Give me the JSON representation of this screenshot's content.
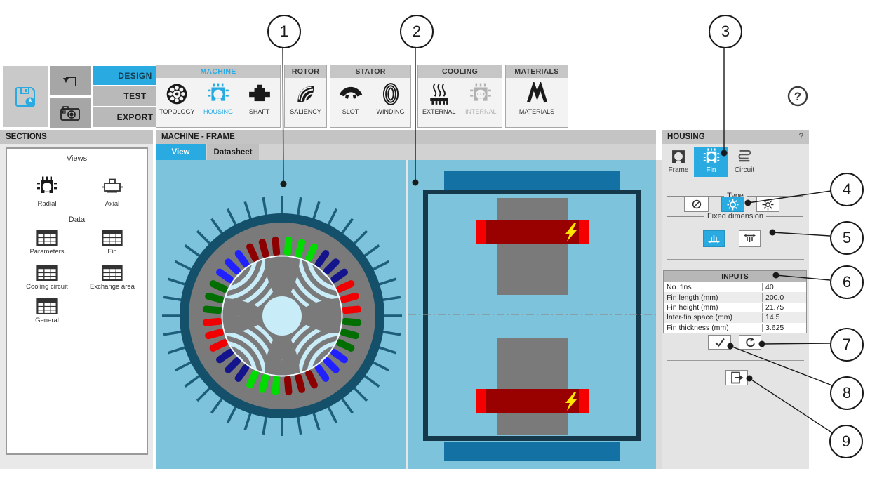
{
  "annotations": {
    "callouts": [
      "1",
      "2",
      "3",
      "4",
      "5",
      "6",
      "7",
      "8",
      "9"
    ]
  },
  "toolbar": {
    "design_label": "DESIGN",
    "test_label": "TEST",
    "export_label": "EXPORT",
    "help": "?",
    "groups": [
      {
        "title": "MACHINE",
        "items": [
          {
            "label": "TOPOLOGY"
          },
          {
            "label": "HOUSING"
          },
          {
            "label": "SHAFT"
          }
        ]
      },
      {
        "title": "ROTOR",
        "items": [
          {
            "label": "SALIENCY"
          }
        ]
      },
      {
        "title": "STATOR",
        "items": [
          {
            "label": "SLOT"
          },
          {
            "label": "WINDING"
          }
        ]
      },
      {
        "title": "COOLING",
        "items": [
          {
            "label": "EXTERNAL"
          },
          {
            "label": "INTERNAL"
          }
        ]
      },
      {
        "title": "MATERIALS",
        "items": [
          {
            "label": "MATERIALS"
          }
        ]
      }
    ]
  },
  "sections": {
    "title": "SECTIONS",
    "views_label": "Views",
    "data_label": "Data",
    "views": [
      "Radial",
      "Axial"
    ],
    "data": [
      "Parameters",
      "Fin",
      "Cooling circuit",
      "Exchange area",
      "General"
    ]
  },
  "main": {
    "title": "MACHINE - FRAME",
    "tabs": [
      "View",
      "Datasheet"
    ],
    "active_tab": "View"
  },
  "housing": {
    "title": "HOUSING",
    "help": "?",
    "tabs": [
      "Frame",
      "Fin",
      "Circuit"
    ],
    "active_tab": "Fin",
    "type_label": "Type",
    "fixed_label": "Fixed dimension",
    "inputs": {
      "header": "INPUTS",
      "rows": [
        [
          "No. fins",
          "40"
        ],
        [
          "Fin length (mm)",
          "200.0"
        ],
        [
          "Fin height (mm)",
          "21.75"
        ],
        [
          "Inter-fin space (mm)",
          "14.5"
        ],
        [
          "Fin thickness (mm)",
          "3.625"
        ]
      ]
    }
  },
  "machine_views": {
    "radial": {
      "fin_count": 40,
      "slot_count": 36,
      "slots_per_phase_band": 3,
      "pole_count": 4,
      "slot_colors_cycle": [
        "#00DC00",
        "#14148C",
        "#F00000",
        "#006E00",
        "#2121FF",
        "#8C0000"
      ]
    },
    "axial": {
      "winding_bars": 2,
      "lightning_markers": 2
    }
  },
  "colors": {
    "accent": "#29ABE2",
    "pane_bg": "#7CC3DB",
    "steel": "#7A7A7A",
    "housing_ring": "#15506A",
    "housing_fin": "#1E5E7B",
    "rotor": "#C9ECF9",
    "frame_dark": "#16384B",
    "end_bar": "#1371A3",
    "winding_dark": "#990000",
    "winding_bright": "#F40000",
    "bolt": "#FFE400"
  }
}
